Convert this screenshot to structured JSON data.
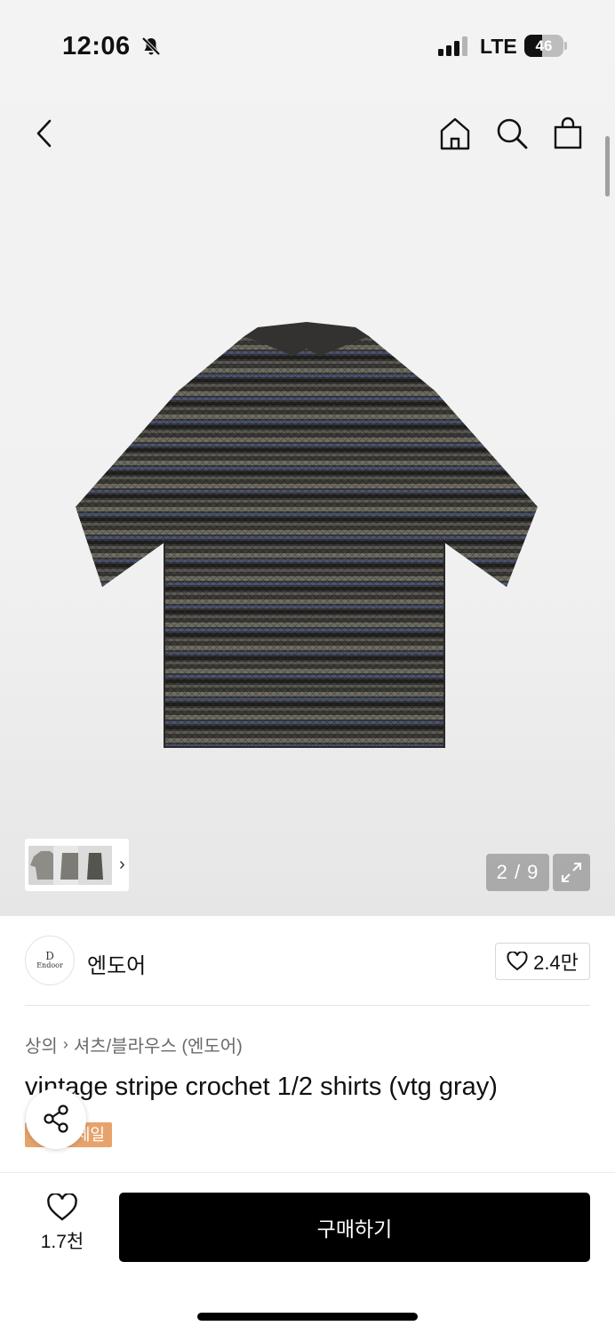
{
  "status_bar": {
    "time": "12:06",
    "network": "LTE",
    "battery": "46",
    "battery_level": 0.46
  },
  "nav": {
    "back_icon": "chevron-left-icon",
    "home_icon": "home-icon",
    "search_icon": "search-icon",
    "bag_icon": "shopping-bag-icon"
  },
  "gallery": {
    "counter": "2 / 9",
    "thumbnail_chevron": "›",
    "current_index": 2,
    "total": 9
  },
  "brand": {
    "name": "엔도어",
    "logo_mark": "D",
    "logo_word": "Endoor",
    "likes": "2.4만"
  },
  "breadcrumb": {
    "category": "상의",
    "separator": "›",
    "subcategory": "셔츠/블라우스 (엔도어)"
  },
  "product": {
    "title": "vintage stripe crochet 1/2 shirts (vtg gray)",
    "tag": "세일"
  },
  "bottom_bar": {
    "wish_count": "1.7천",
    "buy_label": "구매하기"
  },
  "colors": {
    "accent_tag": "#e7a36b",
    "buy_button": "#000000",
    "shirt_base": "#3b3a37",
    "stripe_blue": "#4a5576",
    "stripe_olive": "#6f6e62"
  }
}
